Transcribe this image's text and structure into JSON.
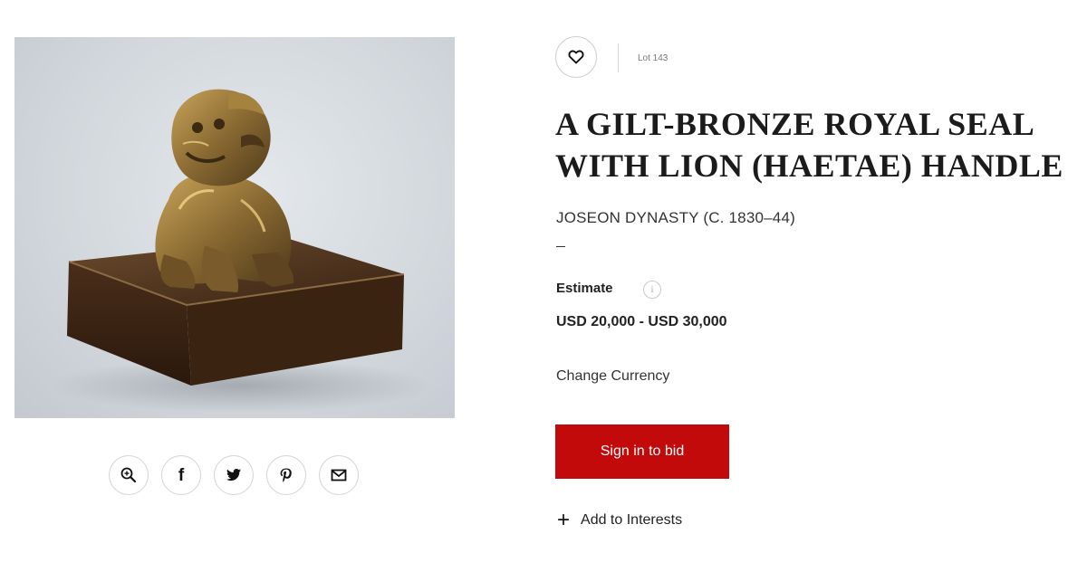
{
  "lot": {
    "label": "Lot 143",
    "title_line1": "A GILT-BRONZE ROYAL SEAL",
    "title_line2": "WITH LION (HAETAE) HANDLE",
    "subtitle": "JOSEON DYNASTY (C. 1830–44)"
  },
  "estimate": {
    "label": "Estimate",
    "info_icon": "info-icon",
    "value": "USD 20,000 - USD 30,000"
  },
  "actions": {
    "change_currency": "Change Currency",
    "bid_label": "Sign in to bid",
    "interests_label": "Add to Interests",
    "favorite_icon": "heart-icon"
  },
  "share_icons": [
    "zoom-icon",
    "facebook-icon",
    "twitter-icon",
    "pinterest-icon",
    "email-icon"
  ],
  "colors": {
    "bid_button": "#c20a0a",
    "text": "#1b1b1b"
  }
}
